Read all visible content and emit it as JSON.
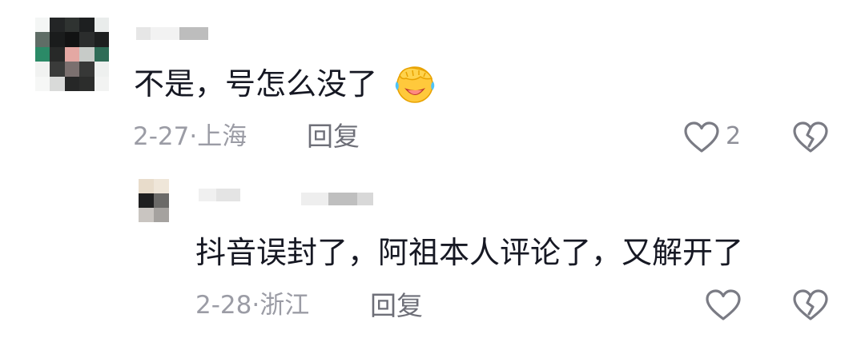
{
  "comment": {
    "text": "不是，号怎么没了",
    "emoji_icon": "face-palm-laughing-emoji",
    "date": "2-27",
    "location": "上海",
    "reply_label": "回复",
    "like_count": "2",
    "avatar_pixels": [
      "#f4f6f5",
      "#232526",
      "#2f3331",
      "#1d1f20",
      "#e9eceb",
      "#5f6d66",
      "#1a1c1c",
      "#121313",
      "#2b2d2d",
      "#1d1f1f",
      "#2b8a67",
      "#272928",
      "#e4a8a3",
      "#c7cbc8",
      "#2f6c57",
      "#f1f2f1",
      "#3a3b3a",
      "#7b706f",
      "#373837",
      "#eef0ef",
      "#f6f7f6",
      "#d9dad9",
      "#262727",
      "#2c2d2c",
      "#f2f3f2"
    ],
    "name_blur": [
      "#e6e6e6",
      "#f2f2f2",
      "#bdbdbd"
    ]
  },
  "reply": {
    "text": "抖音误封了，阿祖本人评论了，又解开了",
    "date": "2-28",
    "location": "浙江",
    "reply_label": "回复",
    "avatar_pixels": [
      "#e8dccb",
      "#efe6d9",
      "#1f1f20",
      "#6b6a68",
      "#c9c5c1",
      "#a5a29f"
    ],
    "name_blur_1": [
      "#f0f0f0",
      "#e4e4e4"
    ],
    "name_blur_2": [
      "#eeeeee",
      "#bfbfbf",
      "#d8d8d8"
    ]
  },
  "colors": {
    "text_primary": "#161823",
    "text_meta": "#9b9ca5",
    "reply_button": "#6e6f78",
    "icon": "#7a7b84"
  }
}
